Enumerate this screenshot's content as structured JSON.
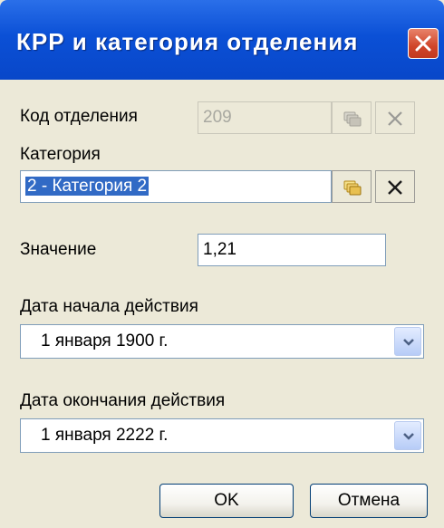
{
  "window": {
    "title": "КРР и категория отделения"
  },
  "form": {
    "department_code": {
      "label": "Код отделения",
      "value": "209"
    },
    "category": {
      "label": "Категория",
      "value": "2 - Категория 2"
    },
    "value_field": {
      "label": "Значение",
      "value": "1,21"
    },
    "start_date": {
      "label": "Дата начала действия",
      "value": "1  января  1900 г."
    },
    "end_date": {
      "label": "Дата окончания действия",
      "value": "1  января  2222 г."
    }
  },
  "buttons": {
    "ok": "OK",
    "cancel": "Отмена"
  },
  "colors": {
    "title_bar": "#0b50d6",
    "window_bg": "#ece9d8",
    "selection": "#316ac5",
    "close_button": "#d0452a"
  },
  "icons": {
    "close": "close-icon",
    "lookup": "folder-stack-icon",
    "clear": "x-clear-icon",
    "dropdown": "chevron-down-icon"
  }
}
